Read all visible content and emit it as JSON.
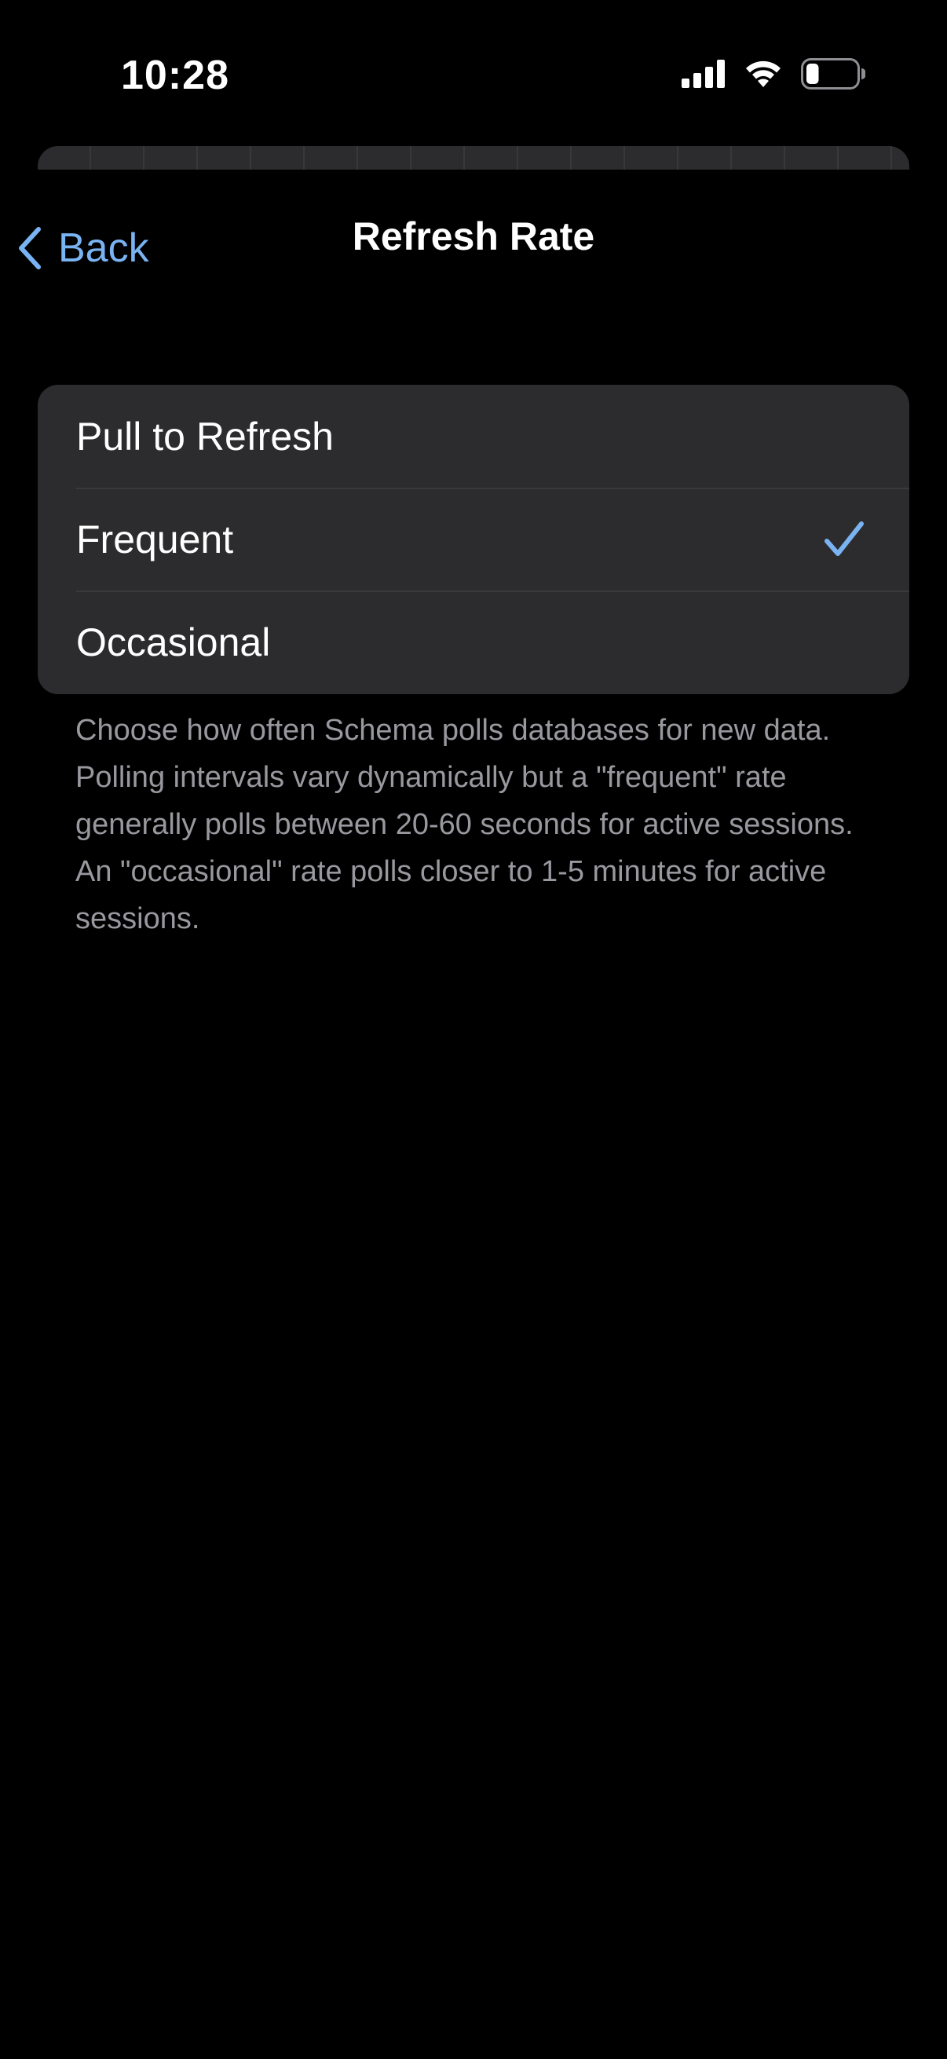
{
  "status_bar": {
    "time": "10:28",
    "icons": [
      "signal-icon",
      "wifi-icon",
      "battery-icon"
    ],
    "battery_level": 0.25
  },
  "nav": {
    "back_label": "Back",
    "title": "Refresh Rate"
  },
  "options": {
    "items": [
      {
        "label": "Pull to Refresh",
        "selected": false
      },
      {
        "label": "Frequent",
        "selected": true
      },
      {
        "label": "Occasional",
        "selected": false
      }
    ]
  },
  "footer": {
    "description": "Choose how often Schema polls databases for new data. Polling intervals vary dynamically but a \"frequent\" rate generally polls between 20-60 seconds for active sessions. An \"occasional\" rate polls closer to 1-5 minutes for active sessions."
  },
  "colors": {
    "background": "#000000",
    "group_background": "#2c2c2e",
    "separator": "#3a3a3c",
    "accent": "#7ab3f2",
    "secondary_text": "#98989f"
  }
}
